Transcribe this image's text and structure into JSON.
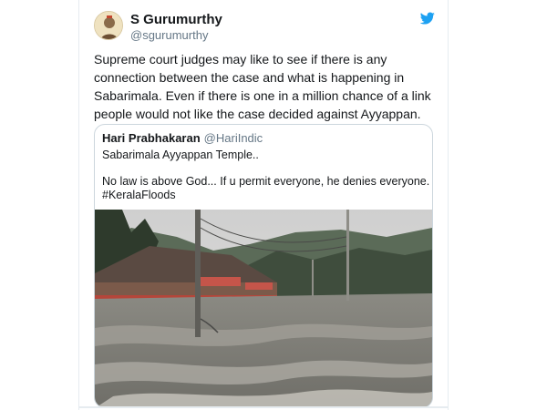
{
  "tweet": {
    "author_name": "S Gurumurthy",
    "author_handle": "@sgurumurthy",
    "text": "Supreme court judges may like to see if there is any connection between the case and what is happening in Sabarimala. Even if there is one in a million chance of a link people would not like the case decided against Ayyappan.",
    "icons": {
      "avatar": "avatar-portrait",
      "platform": "twitter-bird-icon"
    },
    "colors": {
      "brand_blue": "#1da1f2",
      "text": "#14171a",
      "secondary": "#657786",
      "border": "#ccd6dd"
    }
  },
  "quoted": {
    "author_name": "Hari Prabhakaran",
    "author_handle": "@HariIndic",
    "line1": "Sabarimala Ayyappan Temple..",
    "line2": "No law is above God... If u permit everyone, he denies everyone.",
    "hashtag": "#KeralaFloods"
  }
}
